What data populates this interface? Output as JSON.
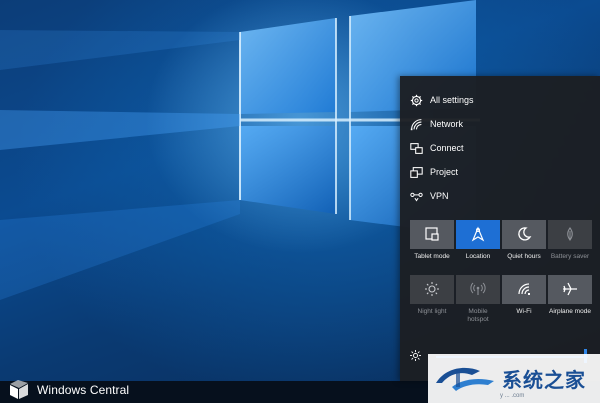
{
  "action_center": {
    "quick_links": [
      {
        "label": "All settings",
        "icon": "gear-icon"
      },
      {
        "label": "Network",
        "icon": "network-icon"
      },
      {
        "label": "Connect",
        "icon": "connect-icon"
      },
      {
        "label": "Project",
        "icon": "project-icon"
      },
      {
        "label": "VPN",
        "icon": "vpn-icon"
      }
    ],
    "tiles": [
      {
        "label": "Tablet mode",
        "state": "off",
        "icon": "tablet-icon"
      },
      {
        "label": "Location",
        "state": "on",
        "icon": "location-icon"
      },
      {
        "label": "Quiet hours",
        "state": "off",
        "icon": "moon-icon"
      },
      {
        "label": "Battery saver",
        "state": "disabled",
        "icon": "battery-saver-icon"
      },
      {
        "label": "Night light",
        "state": "disabled",
        "icon": "night-light-icon"
      },
      {
        "label": "Mobile hotspot",
        "state": "disabled",
        "icon": "hotspot-icon"
      },
      {
        "label": "Wi-Fi",
        "state": "off",
        "icon": "wifi-icon"
      },
      {
        "label": "Airplane mode",
        "state": "off",
        "icon": "airplane-icon"
      }
    ],
    "brightness": {
      "icon": "brightness-icon",
      "level": 0.97
    }
  },
  "watermark": {
    "brand": "Windows Central"
  },
  "site_watermark": {
    "text": "系统之家",
    "sub": "y ... .com"
  },
  "colors": {
    "accent": "#1e6fd4",
    "panel": "#1c1e22",
    "tile": "#555960"
  }
}
